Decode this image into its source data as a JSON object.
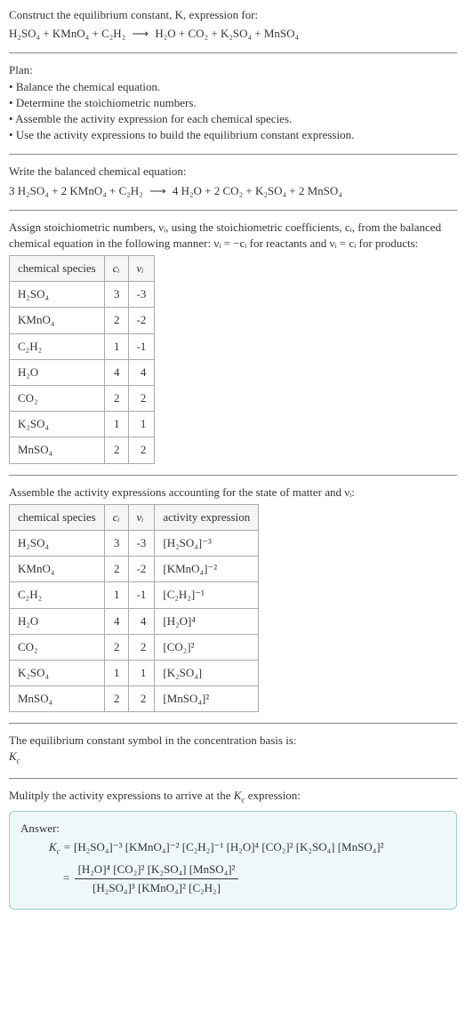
{
  "header": {
    "line1": "Construct the equilibrium constant, K, expression for:",
    "eq_lhs": "H₂SO₄ + KMnO₄ + C₂H₂",
    "eq_rhs": "H₂O + CO₂ + K₂SO₄ + MnSO₄"
  },
  "plan": {
    "title": "Plan:",
    "items": [
      "Balance the chemical equation.",
      "Determine the stoichiometric numbers.",
      "Assemble the activity expression for each chemical species.",
      "Use the activity expressions to build the equilibrium constant expression."
    ]
  },
  "balanced": {
    "title": "Write the balanced chemical equation:",
    "eq_lhs": "3 H₂SO₄ + 2 KMnO₄ + C₂H₂",
    "eq_rhs": "4 H₂O + 2 CO₂ + K₂SO₄ + 2 MnSO₄"
  },
  "stoich": {
    "intro_a": "Assign stoichiometric numbers, νᵢ, using the stoichiometric coefficients, cᵢ, from the balanced chemical equation in the following manner: νᵢ = −cᵢ for reactants and νᵢ = cᵢ for products:",
    "headers": {
      "species": "chemical species",
      "ci": "cᵢ",
      "vi": "νᵢ"
    },
    "rows": [
      {
        "sp": "H₂SO₄",
        "c": "3",
        "v": "-3"
      },
      {
        "sp": "KMnO₄",
        "c": "2",
        "v": "-2"
      },
      {
        "sp": "C₂H₂",
        "c": "1",
        "v": "-1"
      },
      {
        "sp": "H₂O",
        "c": "4",
        "v": "4"
      },
      {
        "sp": "CO₂",
        "c": "2",
        "v": "2"
      },
      {
        "sp": "K₂SO₄",
        "c": "1",
        "v": "1"
      },
      {
        "sp": "MnSO₄",
        "c": "2",
        "v": "2"
      }
    ]
  },
  "activity": {
    "intro": "Assemble the activity expressions accounting for the state of matter and νᵢ:",
    "headers": {
      "species": "chemical species",
      "ci": "cᵢ",
      "vi": "νᵢ",
      "act": "activity expression"
    },
    "rows": [
      {
        "sp": "H₂SO₄",
        "c": "3",
        "v": "-3",
        "a": "[H₂SO₄]⁻³"
      },
      {
        "sp": "KMnO₄",
        "c": "2",
        "v": "-2",
        "a": "[KMnO₄]⁻²"
      },
      {
        "sp": "C₂H₂",
        "c": "1",
        "v": "-1",
        "a": "[C₂H₂]⁻¹"
      },
      {
        "sp": "H₂O",
        "c": "4",
        "v": "4",
        "a": "[H₂O]⁴"
      },
      {
        "sp": "CO₂",
        "c": "2",
        "v": "2",
        "a": "[CO₂]²"
      },
      {
        "sp": "K₂SO₄",
        "c": "1",
        "v": "1",
        "a": "[K₂SO₄]"
      },
      {
        "sp": "MnSO₄",
        "c": "2",
        "v": "2",
        "a": "[MnSO₄]²"
      }
    ]
  },
  "basis": {
    "line1": "The equilibrium constant symbol in the concentration basis is:",
    "symbol": "K_c"
  },
  "final": {
    "intro": "Mulitply the activity expressions to arrive at the K_c expression:",
    "answer_label": "Answer:",
    "kc_prefix": "K_c =",
    "product_line": "[H₂SO₄]⁻³ [KMnO₄]⁻² [C₂H₂]⁻¹ [H₂O]⁴ [CO₂]² [K₂SO₄] [MnSO₄]²",
    "frac_num": "[H₂O]⁴ [CO₂]² [K₂SO₄] [MnSO₄]²",
    "frac_den": "[H₂SO₄]³ [KMnO₄]² [C₂H₂]",
    "eq_sign": "="
  }
}
